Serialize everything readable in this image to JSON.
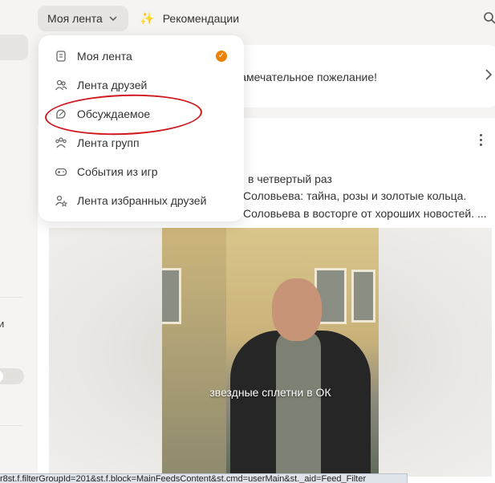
{
  "topbar": {
    "feed_tab_label": "Моя лента",
    "recommendations_label": "Рекомендации"
  },
  "dropdown": {
    "items": [
      {
        "label": "Моя лента",
        "icon": "feed-icon",
        "selected": true
      },
      {
        "label": "Лента друзей",
        "icon": "friends-icon"
      },
      {
        "label": "Обсуждаемое",
        "icon": "discussion-icon"
      },
      {
        "label": "Лента групп",
        "icon": "groups-icon"
      },
      {
        "label": "События из игр",
        "icon": "gamepad-icon"
      },
      {
        "label": "Лента избранных друзей",
        "icon": "favorite-friends-icon"
      }
    ]
  },
  "wish_card": {
    "text": "! Замечательное пожелание!"
  },
  "post": {
    "lines": [
      "в четвертый раз",
      "Соловьева: тайна, розы и золотые кольца.",
      "Соловьева в восторге от хороших новостей. ..."
    ],
    "video_caption": "звездные сплетни в ОК"
  },
  "sidebar": {
    "partial_text": "и"
  },
  "statusbar": {
    "url": "r8st.f.filterGroupId=201&st.f.block=MainFeedsContent&st.cmd=userMain&st._aid=Feed_Filter"
  },
  "colors": {
    "accent_orange": "#ee8208",
    "annotation_red": "#d0191f"
  }
}
